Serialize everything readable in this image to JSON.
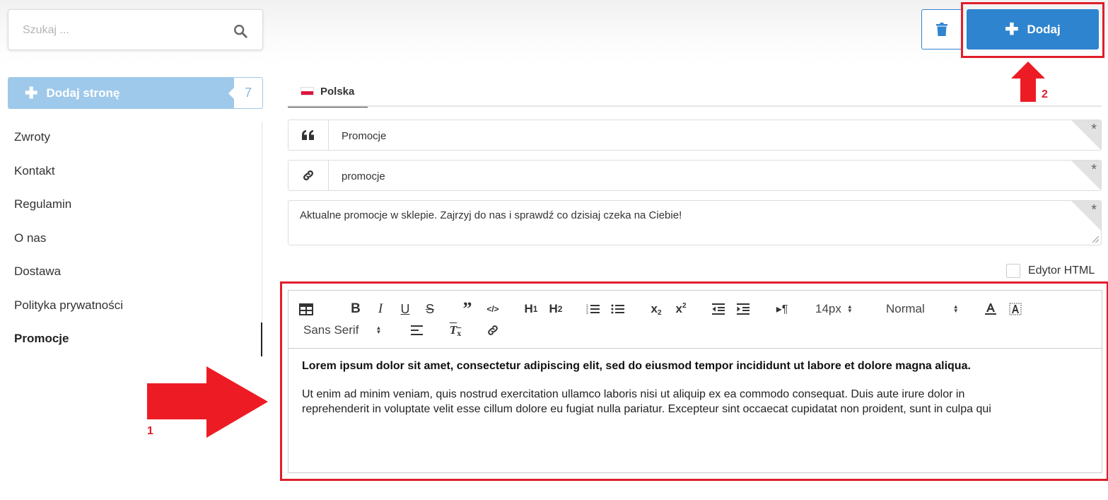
{
  "search": {
    "placeholder": "Szukaj ..."
  },
  "sidebar": {
    "add_page_label": "Dodaj stronę",
    "page_count": "7",
    "items": [
      {
        "label": "Zwroty",
        "active": false
      },
      {
        "label": "Kontakt",
        "active": false
      },
      {
        "label": "Regulamin",
        "active": false
      },
      {
        "label": "O nas",
        "active": false
      },
      {
        "label": "Dostawa",
        "active": false
      },
      {
        "label": "Polityka prywatności",
        "active": false
      },
      {
        "label": "Promocje",
        "active": true
      }
    ]
  },
  "header": {
    "add_label": "Dodaj"
  },
  "tabs": [
    {
      "label": "Polska",
      "active": true
    }
  ],
  "form": {
    "title_value": "Promocje",
    "slug_value": "promocje",
    "description_value": "Aktualne promocje w sklepie. Zajrzyj do nas i sprawdź co dzisiaj czeka na Ciebie!",
    "required_mark": "*",
    "html_editor_label": "Edytor HTML"
  },
  "editor": {
    "font_size": "14px",
    "heading": "Normal",
    "font_family": "Sans Serif",
    "content_bold": "Lorem ipsum dolor sit amet, consectetur adipiscing elit, sed do eiusmod tempor incididunt ut labore et dolore magna aliqua.",
    "content_body": "Ut enim ad minim veniam, quis nostrud exercitation ullamco laboris nisi ut aliquip ex ea commodo consequat. Duis aute irure dolor in\nreprehenderit in voluptate velit esse cillum dolore eu fugiat nulla pariatur. Excepteur sint occaecat cupidatat non proident, sunt in culpa qui"
  },
  "annotations": {
    "label_1": "1",
    "label_2": "2"
  },
  "colors": {
    "primary": "#2f84cf",
    "primary_light": "#9fc9ea",
    "highlight": "#e01e2b"
  }
}
